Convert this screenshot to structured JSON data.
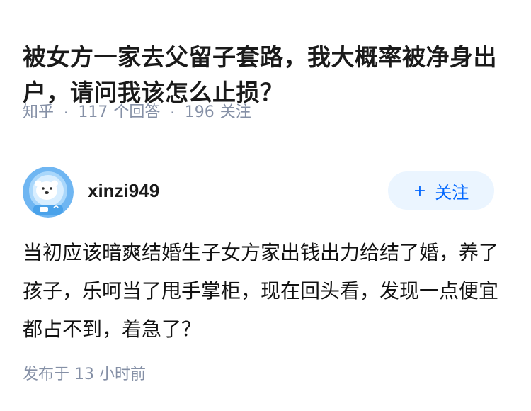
{
  "question": {
    "title": "被女方一家去父留子套路，我大概率被净身出户，请问我该怎么止损？"
  },
  "meta": {
    "source": "知乎",
    "separator": "·",
    "answers_count": "117",
    "answers_label": "个回答",
    "followers_count": "196",
    "followers_label": "关注"
  },
  "author": {
    "username": "xinzi949",
    "avatar_icon": "polar-bear-astronaut-avatar-icon"
  },
  "follow_button": {
    "icon": "+",
    "label": "关注"
  },
  "answer": {
    "content": "当初应该暗爽结婚生子女方家出钱出力给结了婚，养了孩子，乐呵当了甩手掌柜，现在回头看，发现一点便宜都占不到，着急了？"
  },
  "footer": {
    "publish_label": "发布于",
    "publish_time": "13 小时前"
  },
  "colors": {
    "accent": "#0066ff",
    "button_bg": "#ebf5ff",
    "meta_text": "#8590a6",
    "title_text": "#1a1a1a"
  }
}
